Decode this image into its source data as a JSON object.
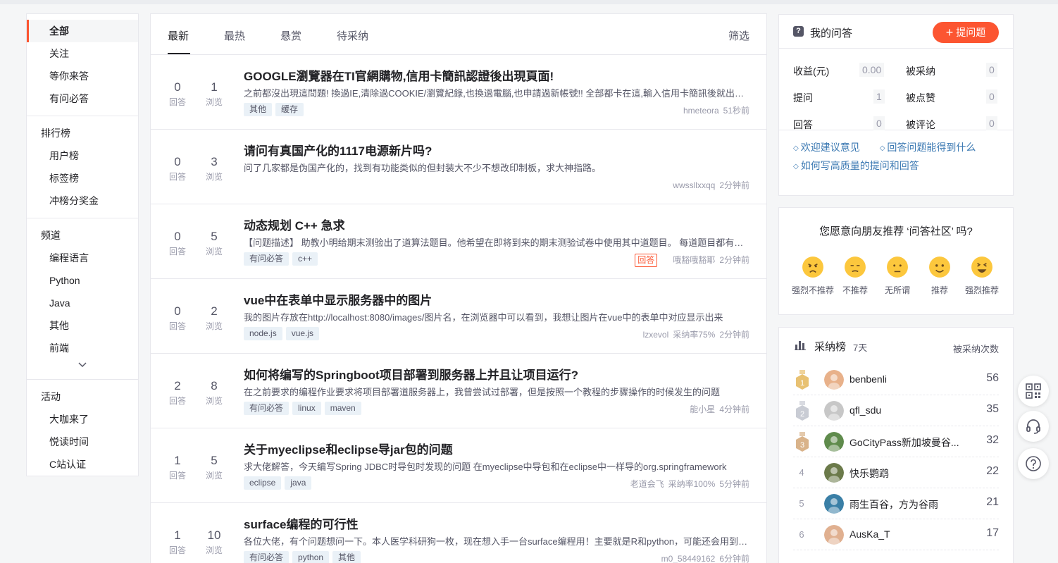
{
  "sidebar": {
    "groups": [
      {
        "head": "",
        "items": [
          "全部",
          "关注",
          "等你来答",
          "有问必答"
        ]
      },
      {
        "head": "排行榜",
        "items": [
          "用户榜",
          "标签榜",
          "冲榜分奖金"
        ]
      },
      {
        "head": "频道",
        "items": [
          "编程语言",
          "Python",
          "Java",
          "其他",
          "前端"
        ]
      },
      {
        "head": "活动",
        "items": [
          "大咖来了",
          "悦读时间",
          "C站认证"
        ]
      }
    ]
  },
  "tabs": [
    "最新",
    "最热",
    "悬赏",
    "待采纳"
  ],
  "filter_label": "筛选",
  "questions": [
    {
      "answers": "0",
      "views": "1",
      "answers_label": "回答",
      "views_label": "浏览",
      "title": "GOOGLE瀏覽器在TI官網購物,信用卡簡訊認證後出現頁面!",
      "desc": "之前都沒出現這問題! 換過IE,清除過COOKIE/瀏覽紀錄,也換過電腦,也申請過新帳號!! 全部都卡在這,輸入信用卡簡訊後就出現以下頁面!",
      "tags": [
        "其他",
        "缓存"
      ],
      "badge": "",
      "author": "hmeteora",
      "rate": "",
      "time": "51秒前"
    },
    {
      "answers": "0",
      "views": "3",
      "answers_label": "回答",
      "views_label": "浏览",
      "title": "请问有真国产化的1117电源新片吗?",
      "desc": "问了几家都是伪国产化的，找到有功能类似的但封装大不少不想改印制板，求大神指路。",
      "tags": [],
      "badge": "",
      "author": "wwssllxxqq",
      "rate": "",
      "time": "2分钟前"
    },
    {
      "answers": "0",
      "views": "5",
      "answers_label": "回答",
      "views_label": "浏览",
      "title": "动态规划 C++ 急求",
      "desc": "【问题描述】 助教小明给期末测验出了道算法题目。他希望在即将到来的期末测验试卷中使用其中道题目。 每道题目都有一个难度值",
      "tags": [
        "有问必答",
        "c++"
      ],
      "badge": "回答",
      "author": "哦豁哦豁耶",
      "rate": "",
      "time": "2分钟前"
    },
    {
      "answers": "0",
      "views": "2",
      "answers_label": "回答",
      "views_label": "浏览",
      "title": "vue中在表单中显示服务器中的图片",
      "desc": "我的图片存放在http://localhost:8080/images/图片名，在浏览器中可以看到，我想让图片在vue中的表单中对应显示出来",
      "tags": [
        "node.js",
        "vue.js"
      ],
      "badge": "",
      "author": "lzxevol",
      "rate": "采纳率75%",
      "time": "2分钟前"
    },
    {
      "answers": "2",
      "views": "8",
      "answers_label": "回答",
      "views_label": "浏览",
      "title": "如何将编写的Springboot项目部署到服务器上并且让项目运行?",
      "desc": "在之前要求的编程作业要求将项目部署道服务器上，我曾尝试过部署，但是按照一个教程的步骤操作的时候发生的问题",
      "tags": [
        "有问必答",
        "linux",
        "maven"
      ],
      "badge": "",
      "author": "能小星",
      "rate": "",
      "time": "4分钟前"
    },
    {
      "answers": "1",
      "views": "5",
      "answers_label": "回答",
      "views_label": "浏览",
      "title": "关于myeclipse和eclipse导jar包的问题",
      "desc": "求大佬解答，今天编写Spring JDBC时导包时发现的问题 在myeclipse中导包和在eclipse中一样导的org.springframework",
      "tags": [
        "eclipse",
        "java"
      ],
      "badge": "",
      "author": "老道会飞",
      "rate": "采纳率100%",
      "time": "5分钟前"
    },
    {
      "answers": "1",
      "views": "10",
      "answers_label": "回答",
      "views_label": "浏览",
      "title": "surface编程的可行性",
      "desc": "各位大佬，有个问题想问一下。本人医学科研狗一枚，现在想入手一台surface编程用！主要就是R和python，可能还会用到其他",
      "tags": [
        "有问必答",
        "python",
        "其他"
      ],
      "badge": "",
      "author": "m0_58449162",
      "rate": "",
      "time": "6分钟前"
    }
  ],
  "my_qa": {
    "title": "我的问答",
    "ask_button": "提问题",
    "ask_plus": "+",
    "stats": [
      {
        "label": "收益(元)",
        "value": "0.00"
      },
      {
        "label": "被采纳",
        "value": "0"
      },
      {
        "label": "提问",
        "value": "1"
      },
      {
        "label": "被点赞",
        "value": "0"
      },
      {
        "label": "回答",
        "value": "0"
      },
      {
        "label": "被评论",
        "value": "0"
      }
    ],
    "links": [
      "欢迎建议意见",
      "回答问题能得到什么",
      "如何写高质量的提问和回答"
    ]
  },
  "recommend": {
    "title": "您愿意向朋友推荐 ‘问答社区’ 吗?",
    "options": [
      "强烈不推荐",
      "不推荐",
      "无所谓",
      "推荐",
      "强烈推荐"
    ]
  },
  "rank": {
    "title": "采纳榜",
    "days": "7天",
    "column": "被采纳次数",
    "entries": [
      {
        "no": "1",
        "name": "benbenli",
        "count": "56"
      },
      {
        "no": "2",
        "name": "qfl_sdu",
        "count": "35"
      },
      {
        "no": "3",
        "name": "GoCityPass新加坡曼谷...",
        "count": "32"
      },
      {
        "no": "4",
        "name": "快乐鹦鹉",
        "count": "22"
      },
      {
        "no": "5",
        "name": "雨生百谷，方为谷雨",
        "count": "21"
      },
      {
        "no": "6",
        "name": "AusKa_T",
        "count": "17"
      }
    ]
  },
  "colors": {
    "accent": "#fc5531",
    "link": "#3d7ab3",
    "tag_bg": "#eaf1f7",
    "gold": "#e8c172",
    "silver": "#c9ccd4",
    "bronze": "#d9b38a"
  },
  "icons": [
    "question-icon",
    "plus-icon",
    "bar-chart-icon",
    "qrcode-icon",
    "headset-icon",
    "help-icon",
    "chevron-down-icon"
  ]
}
